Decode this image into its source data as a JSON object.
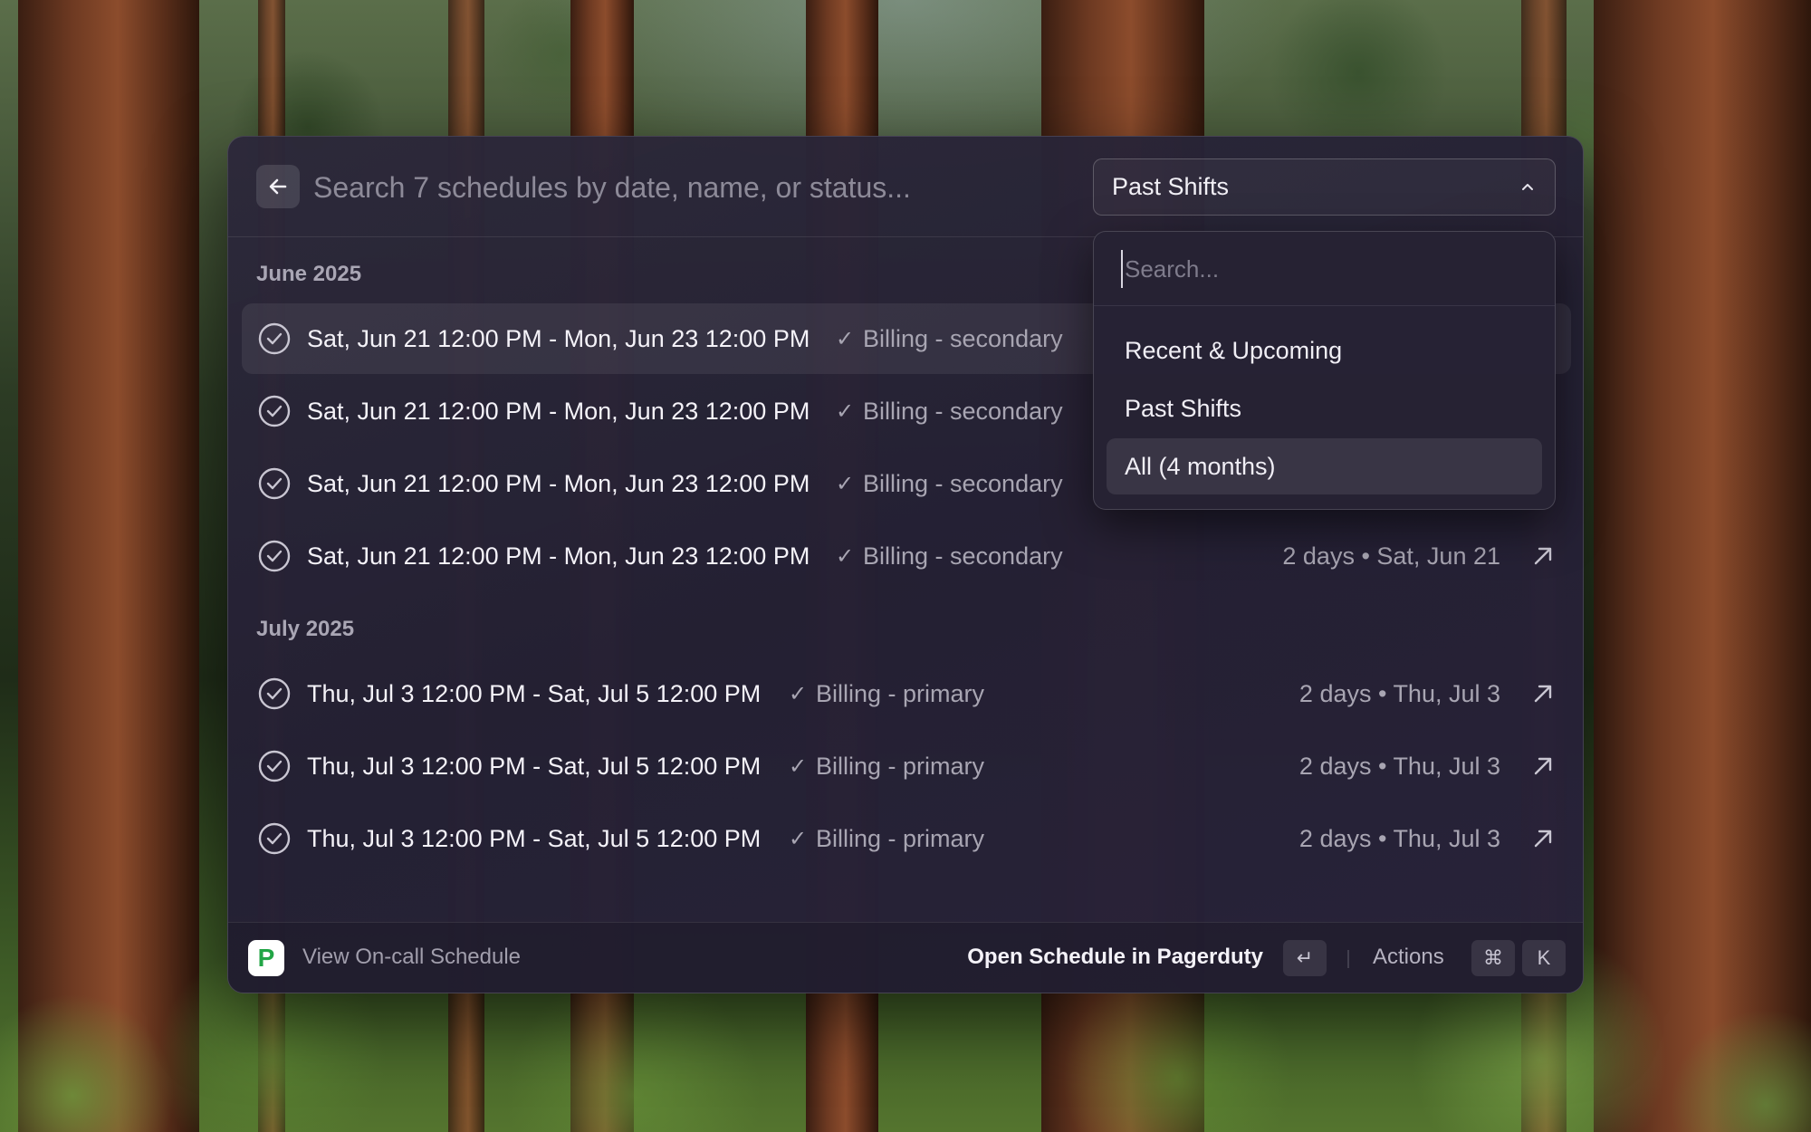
{
  "header": {
    "back_icon": "arrow-left-icon",
    "search_placeholder": "Search 7 schedules by date, name, or status...",
    "filter": {
      "selected": "Past Shifts",
      "icon": "chevron-up-icon"
    }
  },
  "sections": [
    {
      "title": "June 2025",
      "rows": [
        {
          "range": "Sat, Jun 21 12:00 PM - Mon, Jun 23 12:00 PM",
          "check": "✓",
          "tag": "Billing - secondary",
          "meta": "",
          "selected": true
        },
        {
          "range": "Sat, Jun 21 12:00 PM - Mon, Jun 23 12:00 PM",
          "check": "✓",
          "tag": "Billing - secondary",
          "meta": ""
        },
        {
          "range": "Sat, Jun 21 12:00 PM - Mon, Jun 23 12:00 PM",
          "check": "✓",
          "tag": "Billing - secondary",
          "meta": ""
        },
        {
          "range": "Sat, Jun 21 12:00 PM - Mon, Jun 23 12:00 PM",
          "check": "✓",
          "tag": "Billing - secondary",
          "meta": "2 days • Sat, Jun 21"
        }
      ]
    },
    {
      "title": "July 2025",
      "rows": [
        {
          "range": "Thu, Jul 3 12:00 PM - Sat, Jul 5 12:00 PM",
          "check": "✓",
          "tag": "Billing - primary",
          "meta": "2 days • Thu, Jul 3"
        },
        {
          "range": "Thu, Jul 3 12:00 PM - Sat, Jul 5 12:00 PM",
          "check": "✓",
          "tag": "Billing - primary",
          "meta": "2 days • Thu, Jul 3"
        },
        {
          "range": "Thu, Jul 3 12:00 PM - Sat, Jul 5 12:00 PM",
          "check": "✓",
          "tag": "Billing - primary",
          "meta": "2 days • Thu, Jul 3"
        }
      ]
    }
  ],
  "dropdown": {
    "search_placeholder": "Search...",
    "options": [
      "Recent & Upcoming",
      "Past Shifts",
      "All (4 months)"
    ],
    "highlighted": "All (4 months)"
  },
  "footer": {
    "app_icon_letter": "P",
    "title": "View On-call Schedule",
    "primary_action": "Open Schedule in Pagerduty",
    "primary_key": "↵",
    "actions_label": "Actions",
    "actions_keys": [
      "⌘",
      "K"
    ]
  },
  "colors": {
    "panel_bg": "#2a2638",
    "text_primary": "#f4f2f8",
    "text_secondary": "#a8a5b2",
    "pagerduty_green": "#22a546"
  }
}
